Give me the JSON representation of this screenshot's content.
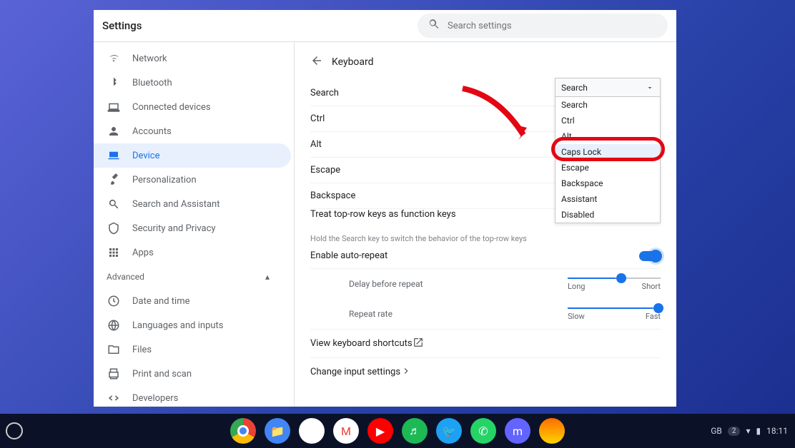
{
  "app_title": "Settings",
  "search_placeholder": "Search settings",
  "sidebar": {
    "items": [
      {
        "label": "Network",
        "icon": "wifi"
      },
      {
        "label": "Bluetooth",
        "icon": "bt"
      },
      {
        "label": "Connected devices",
        "icon": "devices"
      },
      {
        "label": "Accounts",
        "icon": "person"
      },
      {
        "label": "Device",
        "icon": "laptop",
        "active": true
      },
      {
        "label": "Personalization",
        "icon": "brush"
      },
      {
        "label": "Search and Assistant",
        "icon": "search"
      },
      {
        "label": "Security and Privacy",
        "icon": "shield"
      },
      {
        "label": "Apps",
        "icon": "apps"
      }
    ],
    "advanced_label": "Advanced",
    "advanced_items": [
      {
        "label": "Date and time",
        "icon": "clock"
      },
      {
        "label": "Languages and inputs",
        "icon": "globe"
      },
      {
        "label": "Files",
        "icon": "folder"
      },
      {
        "label": "Print and scan",
        "icon": "print"
      },
      {
        "label": "Developers",
        "icon": "code"
      }
    ]
  },
  "page": {
    "title": "Keyboard",
    "rows": [
      {
        "label": "Search"
      },
      {
        "label": "Ctrl"
      },
      {
        "label": "Alt"
      },
      {
        "label": "Escape"
      },
      {
        "label": "Backspace"
      }
    ],
    "fn_title": "Treat top-row keys as function keys",
    "fn_sub": "Hold the Search key to switch the behavior of the top-row keys",
    "autorepeat": "Enable auto-repeat",
    "delay_label": "Delay before repeat",
    "delay_min": "Long",
    "delay_max": "Short",
    "rate_label": "Repeat rate",
    "rate_min": "Slow",
    "rate_max": "Fast",
    "shortcuts": "View keyboard shortcuts",
    "input": "Change input settings"
  },
  "dropdown": {
    "selected": "Search",
    "options": [
      "Search",
      "Ctrl",
      "Alt",
      "Caps Lock",
      "Escape",
      "Backspace",
      "Assistant",
      "Disabled"
    ],
    "highlight_index": 3
  },
  "tray": {
    "lang": "GB",
    "notif": "2",
    "time": "18:11"
  }
}
